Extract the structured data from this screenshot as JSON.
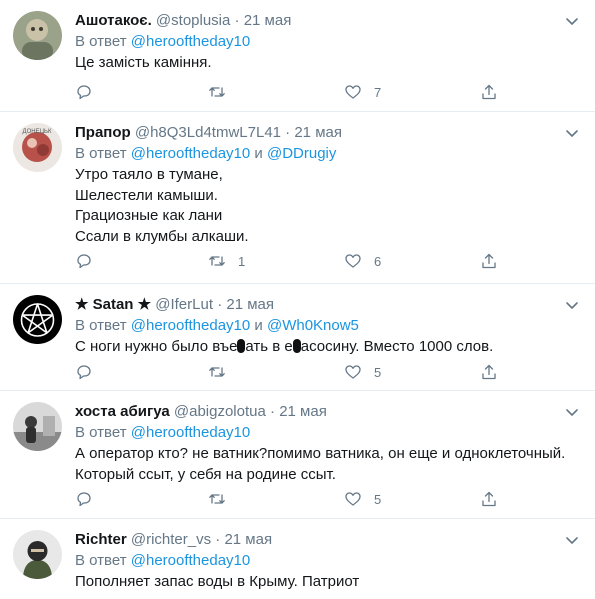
{
  "tweets": [
    {
      "name": "Ашотакоє.",
      "handle": "@stoplusia",
      "date": "21 мая",
      "reply_prefix": "В ответ",
      "reply_to": [
        "@herooftheday10"
      ],
      "lines": [
        "Це замість каміння."
      ],
      "retweets": "",
      "likes": "7"
    },
    {
      "name": "Прапор",
      "handle": "@h8Q3Ld4tmwL7L41",
      "date": "21 мая",
      "reply_prefix": "В ответ",
      "reply_to": [
        "@herooftheday10",
        "@DDrugiy"
      ],
      "reply_joiner": "и",
      "lines": [
        "Утро таяло в тумане,",
        "Шелестели камыши.",
        "Грациозные как лани",
        "Ссали в клумбы алкаши."
      ],
      "retweets": "1",
      "likes": "6"
    },
    {
      "name": "★ Satan ★",
      "handle": "@IferLut",
      "date": "21 мая",
      "reply_prefix": "В ответ",
      "reply_to": [
        "@herooftheday10",
        "@Wh0Know5"
      ],
      "reply_joiner": "и",
      "lines": [
        "С ноги нужно было въе",
        "ать в е",
        "асосину. Вместо 1000 слов."
      ],
      "retweets": "",
      "likes": "5"
    },
    {
      "name": "хоста абигуа",
      "handle": "@abigzolotua",
      "date": "21 мая",
      "reply_prefix": "В ответ",
      "reply_to": [
        "@herooftheday10"
      ],
      "lines": [
        "А оператор кто? не ватник?помимо ватника, он еще и одноклеточный.",
        "Который ссыт, у себя на родине ссыт."
      ],
      "retweets": "",
      "likes": "5"
    },
    {
      "name": "Richter",
      "handle": "@richter_vs",
      "date": "21 мая",
      "reply_prefix": "В ответ",
      "reply_to": [
        "@herooftheday10"
      ],
      "lines": [
        "Пополняет запас воды в Крыму. Патриот"
      ]
    }
  ],
  "separator": "·",
  "icons": {
    "reply": "reply-icon",
    "retweet": "retweet-icon",
    "like": "heart-icon",
    "share": "share-icon",
    "more": "chevron-down-icon"
  },
  "colors": {
    "text": "#14171a",
    "muted": "#657786",
    "mention": "#1b95e0",
    "border": "#e6ecf0"
  }
}
